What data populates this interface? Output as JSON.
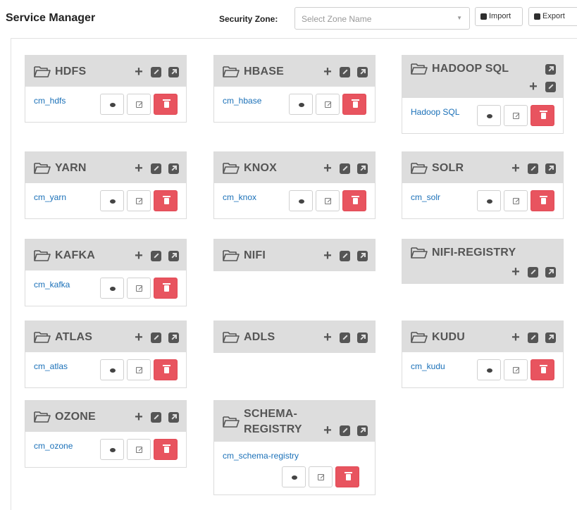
{
  "header": {
    "title": "Service Manager",
    "zone_label": "Security Zone:",
    "zone_placeholder": "Select Zone Name",
    "import_label": "Import",
    "export_label": "Export"
  },
  "colors": {
    "header_bg": "#dddddd",
    "link": "#1a70b8",
    "delete": "#e8545f"
  },
  "services": [
    {
      "name": "HDFS",
      "repo": "cm_hdfs"
    },
    {
      "name": "HBASE",
      "repo": "cm_hbase"
    },
    {
      "name": "HADOOP SQL",
      "repo": "Hadoop SQL"
    },
    {
      "name": "YARN",
      "repo": "cm_yarn"
    },
    {
      "name": "KNOX",
      "repo": "cm_knox"
    },
    {
      "name": "SOLR",
      "repo": "cm_solr"
    },
    {
      "name": "KAFKA",
      "repo": "cm_kafka"
    },
    {
      "name": "NIFI",
      "repo": null
    },
    {
      "name": "NIFI-REGISTRY",
      "repo": null
    },
    {
      "name": "ATLAS",
      "repo": "cm_atlas"
    },
    {
      "name": "ADLS",
      "repo": null
    },
    {
      "name": "KUDU",
      "repo": "cm_kudu"
    },
    {
      "name": "OZONE",
      "repo": "cm_ozone"
    },
    {
      "name": "SCHEMA-REGISTRY",
      "repo": "cm_schema-registry"
    }
  ],
  "icons": {
    "folder": "folder-open-icon",
    "add": "plus-icon",
    "edit": "edit-icon",
    "export": "external-link-icon",
    "view": "eye-icon",
    "repo_edit": "pencil-icon",
    "delete": "trash-icon"
  }
}
